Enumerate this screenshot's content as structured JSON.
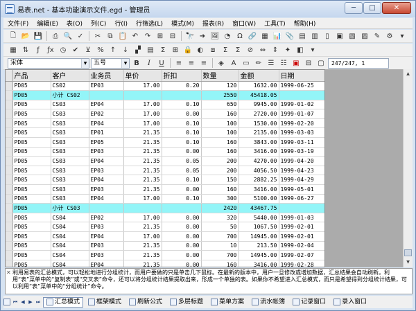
{
  "window": {
    "title": "易表.net - 基本功能演示文件.egd - 管理员",
    "minimize": "─",
    "maximize": "□",
    "close": "✕"
  },
  "menu": [
    "文件(F)",
    "编辑(E)",
    "表(O)",
    "列(C)",
    "行(I)",
    "行筛选(L)",
    "模式(M)",
    "报表(R)",
    "窗口(W)",
    "工具(T)",
    "帮助(H)"
  ],
  "format_bar": {
    "font": "宋体",
    "size": "五号",
    "bold": "B",
    "italic": "I",
    "underline": "U",
    "cell_ref": "247/247, 1"
  },
  "table": {
    "headers": [
      "产品",
      "客户",
      "业务员",
      "单价",
      "折扣",
      "数量",
      "金额",
      "日期"
    ],
    "rows": [
      [
        "PD05",
        "CS02",
        "EP03",
        "17.00",
        "0.20",
        "120",
        "1632.00",
        "1999-06-25"
      ],
      [
        "PD05",
        "小计 CS02",
        "",
        "",
        "",
        "2550",
        "45418.05",
        ""
      ],
      [
        "PD05",
        "CS03",
        "EP04",
        "17.00",
        "0.10",
        "650",
        "9945.00",
        "1999-01-02"
      ],
      [
        "PD05",
        "CS03",
        "EP02",
        "17.00",
        "0.00",
        "160",
        "2720.00",
        "1999-01-07"
      ],
      [
        "PD05",
        "CS03",
        "EP04",
        "17.00",
        "0.10",
        "100",
        "1530.00",
        "1999-02-20"
      ],
      [
        "PD05",
        "CS03",
        "EP01",
        "21.35",
        "0.10",
        "100",
        "2135.00",
        "1999-03-03"
      ],
      [
        "PD05",
        "CS03",
        "EP05",
        "21.35",
        "0.10",
        "160",
        "3843.00",
        "1999-03-11"
      ],
      [
        "PD05",
        "CS03",
        "EP03",
        "21.35",
        "0.00",
        "160",
        "3416.00",
        "1999-03-19"
      ],
      [
        "PD05",
        "CS03",
        "EP04",
        "21.35",
        "0.05",
        "200",
        "4270.00",
        "1999-04-20"
      ],
      [
        "PD05",
        "CS03",
        "EP03",
        "21.35",
        "0.05",
        "200",
        "4056.50",
        "1999-04-23"
      ],
      [
        "PD05",
        "CS03",
        "EP04",
        "21.35",
        "0.10",
        "150",
        "2882.25",
        "1999-04-29"
      ],
      [
        "PD05",
        "CS03",
        "EP03",
        "21.35",
        "0.00",
        "160",
        "3416.00",
        "1999-05-01"
      ],
      [
        "PD05",
        "CS03",
        "EP04",
        "17.00",
        "0.10",
        "300",
        "5100.00",
        "1999-06-27"
      ],
      [
        "PD05",
        "小计 CS03",
        "",
        "",
        "",
        "2420",
        "43467.75",
        ""
      ],
      [
        "PD05",
        "CS04",
        "EP02",
        "17.00",
        "0.00",
        "320",
        "5440.00",
        "1999-01-03"
      ],
      [
        "PD05",
        "CS04",
        "EP03",
        "21.35",
        "0.00",
        "50",
        "1067.50",
        "1999-02-01"
      ],
      [
        "PD05",
        "CS04",
        "EP04",
        "17.00",
        "0.00",
        "700",
        "14945.00",
        "1999-02-01"
      ],
      [
        "PD05",
        "CS04",
        "EP03",
        "21.35",
        "0.00",
        "10",
        "213.50",
        "1999-02-04"
      ],
      [
        "PD05",
        "CS04",
        "EP03",
        "21.35",
        "0.00",
        "700",
        "14945.00",
        "1999-02-07"
      ],
      [
        "PD05",
        "CS04",
        "EP04",
        "21.35",
        "0.00",
        "160",
        "3416.00",
        "1999-02-28"
      ],
      [
        "PD05",
        "CS04",
        "EP03",
        "21.35",
        "0.00",
        "160",
        "3416.00",
        "1999-03-21"
      ]
    ]
  },
  "note": "利用易表的汇总模式，可以轻松地进行分组统计，而用户要做的只是单击几下鼠标。在最新的版本中，用户一旦修改或增加数据，汇总结果会自动刷新。利用“表”菜单中的“复制表”或“交叉表”命令，还可以将分组统计结果提取出来，形成一个单独的表。如果你不希望进入汇总模式，而只是希望得到分组统计结果，可以利用“表”菜单中的“分组统计”命令。",
  "tabs": [
    "汇总模式",
    "框架模式",
    "刷新公式",
    "多层标题",
    "菜单方案",
    "流水帐簿",
    "记录窗口",
    "录入窗口"
  ],
  "nav": [
    "⏮",
    "◀",
    "▶",
    "⏭"
  ]
}
